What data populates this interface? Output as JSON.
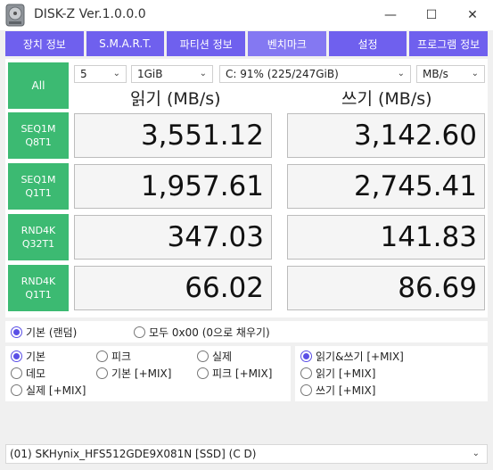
{
  "window": {
    "title": "DISK-Z Ver.1.0.0.0",
    "minimize": "—",
    "maximize": "☐",
    "close": "✕"
  },
  "tabs": [
    "장치 정보",
    "S.M.A.R.T.",
    "파티션 정보",
    "벤치마크",
    "설정",
    "프로그램 정보"
  ],
  "active_tab": "벤치마크",
  "controls": {
    "all_button": "All",
    "count": "5",
    "size": "1GiB",
    "drive": "C: 91% (225/247GiB)",
    "unit": "MB/s"
  },
  "headers": {
    "read": "읽기 (MB/s)",
    "write": "쓰기 (MB/s)"
  },
  "rows": [
    {
      "label1": "SEQ1M",
      "label2": "Q8T1",
      "read": "3,551.12",
      "write": "3,142.60"
    },
    {
      "label1": "SEQ1M",
      "label2": "Q1T1",
      "read": "1,957.61",
      "write": "2,745.41"
    },
    {
      "label1": "RND4K",
      "label2": "Q32T1",
      "read": "347.03",
      "write": "141.83"
    },
    {
      "label1": "RND4K",
      "label2": "Q1T1",
      "read": "66.02",
      "write": "86.69"
    }
  ],
  "data_mode": {
    "random": "기본 (랜덤)",
    "zero": "모두 0x00 (0으로 채우기)"
  },
  "profiles": [
    "기본",
    "피크",
    "실제",
    "데모",
    "기본 [+MIX]",
    "피크 [+MIX]",
    "실제 [+MIX]"
  ],
  "mix_modes": [
    "읽기&쓰기 [+MIX]",
    "읽기 [+MIX]",
    "쓰기 [+MIX]"
  ],
  "device_select": "(01) SKHynix_HFS512GDE9X081N [SSD] (C D)",
  "colors": {
    "accent": "#6f60ee",
    "green": "#3cba72",
    "radio": "#5a4fe6"
  }
}
